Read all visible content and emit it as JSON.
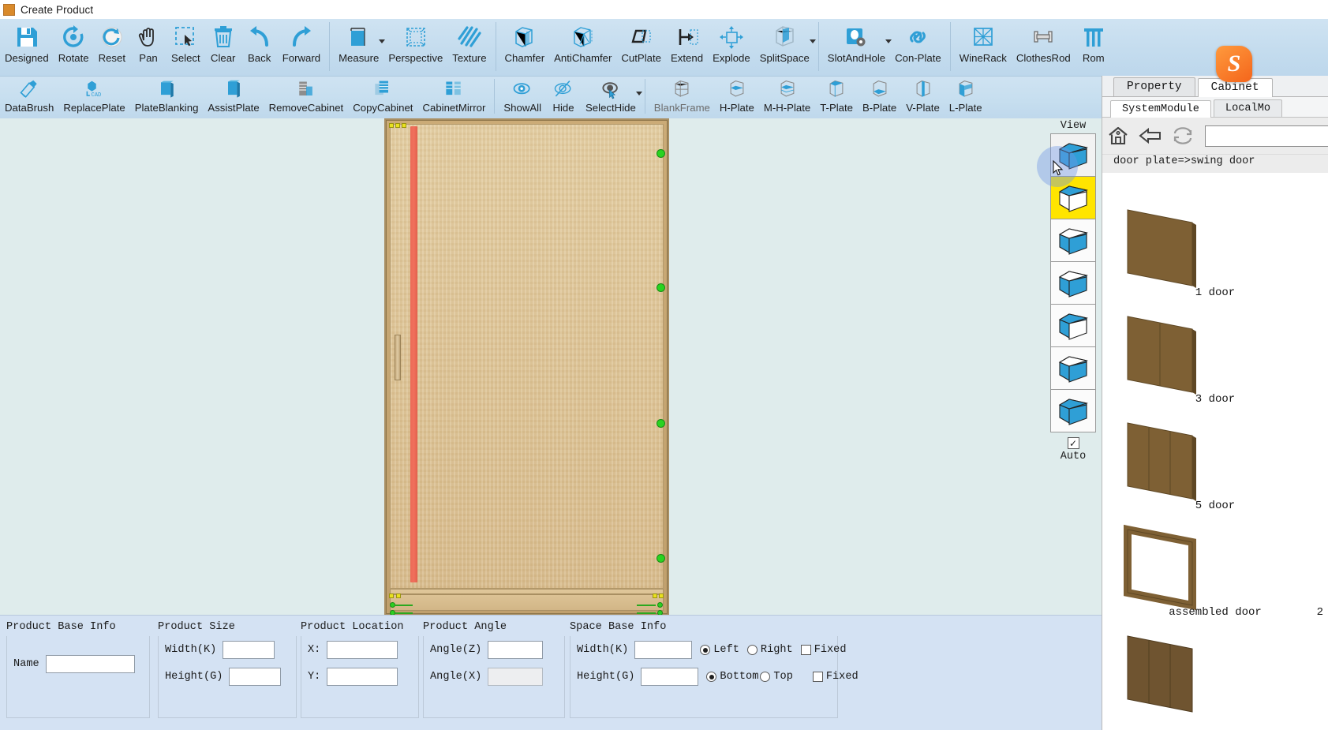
{
  "window": {
    "title": "Create Product"
  },
  "ribbon_row1": [
    {
      "label": "Designed",
      "icon": "save-icon"
    },
    {
      "label": "Rotate",
      "icon": "rotate-icon"
    },
    {
      "label": "Reset",
      "icon": "reset-icon"
    },
    {
      "label": "Pan",
      "icon": "hand-icon"
    },
    {
      "label": "Select",
      "icon": "marquee-select-icon"
    },
    {
      "label": "Clear",
      "icon": "trash-icon"
    },
    {
      "label": "Back",
      "icon": "undo-arrow-icon"
    },
    {
      "label": "Forward",
      "icon": "redo-arrow-icon"
    },
    {
      "label": "Measure",
      "icon": "measure-icon",
      "dropdown": true
    },
    {
      "label": "Perspective",
      "icon": "perspective-icon"
    },
    {
      "label": "Texture",
      "icon": "texture-icon"
    },
    {
      "label": "Chamfer",
      "icon": "chamfer-icon"
    },
    {
      "label": "AntiChamfer",
      "icon": "antichamfer-icon"
    },
    {
      "label": "CutPlate",
      "icon": "cutplate-icon"
    },
    {
      "label": "Extend",
      "icon": "extend-icon"
    },
    {
      "label": "Explode",
      "icon": "explode-icon"
    },
    {
      "label": "SplitSpace",
      "icon": "splitspace-icon",
      "dropdown": true
    },
    {
      "label": "SlotAndHole",
      "icon": "slotandhole-icon",
      "dropdown": true
    },
    {
      "label": "Con-Plate",
      "icon": "chain-link-icon"
    },
    {
      "label": "WineRack",
      "icon": "winerack-icon"
    },
    {
      "label": "ClothesRod",
      "icon": "clothesrod-icon"
    },
    {
      "label": "Rom",
      "icon": "roman-column-icon"
    }
  ],
  "ribbon_row2": [
    {
      "label": "DataBrush",
      "icon": "brush-icon"
    },
    {
      "label": "ReplacePlate",
      "icon": "cad-replace-icon"
    },
    {
      "label": "PlateBlanking",
      "icon": "plate-icon"
    },
    {
      "label": "AssistPlate",
      "icon": "assist-plate-icon"
    },
    {
      "label": "RemoveCabinet",
      "icon": "remove-cabinet-icon"
    },
    {
      "label": "CopyCabinet",
      "icon": "copy-cabinet-icon"
    },
    {
      "label": "CabinetMirror",
      "icon": "cabinet-mirror-icon"
    },
    {
      "label": "ShowAll",
      "icon": "eye-icon"
    },
    {
      "label": "Hide",
      "icon": "eye-slash-icon"
    },
    {
      "label": "SelectHide",
      "icon": "select-hide-icon",
      "dropdown": true
    },
    {
      "label": "BlankFrame",
      "icon": "blank-frame-icon",
      "dim": true
    },
    {
      "label": "H-Plate",
      "icon": "h-plate-icon"
    },
    {
      "label": "M-H-Plate",
      "icon": "mh-plate-icon"
    },
    {
      "label": "T-Plate",
      "icon": "t-plate-icon"
    },
    {
      "label": "B-Plate",
      "icon": "b-plate-icon"
    },
    {
      "label": "V-Plate",
      "icon": "v-plate-icon"
    },
    {
      "label": "L-Plate",
      "icon": "l-plate-icon"
    }
  ],
  "ribbon_overflow": "»",
  "view_panel": {
    "title": "View",
    "auto_label": "Auto",
    "auto_checked": true,
    "cubes": [
      {
        "name": "view-iso-front",
        "state": "selected"
      },
      {
        "name": "view-front-highlight",
        "state": "highlighted"
      },
      {
        "name": "view-iso-top-left",
        "state": "normal"
      },
      {
        "name": "view-iso-top-right",
        "state": "normal"
      },
      {
        "name": "view-iso-bottom",
        "state": "normal"
      },
      {
        "name": "view-iso-top",
        "state": "normal"
      },
      {
        "name": "view-iso-side",
        "state": "normal"
      }
    ]
  },
  "right_panel": {
    "tabs": [
      {
        "label": "Property",
        "active": false
      },
      {
        "label": "Cabinet",
        "active": true
      }
    ],
    "subtabs": [
      {
        "label": "SystemModule",
        "active": true
      },
      {
        "label": "LocalMo",
        "active": false
      }
    ],
    "nav": [
      {
        "name": "home-icon"
      },
      {
        "name": "back-arrow-icon"
      },
      {
        "name": "refresh-icon"
      }
    ],
    "search_value": "",
    "breadcrumb": "door plate=>swing door",
    "modules": [
      {
        "label": "1 door",
        "thumb": "door-panel-1",
        "num": ""
      },
      {
        "label": "3 door",
        "thumb": "door-panel-3",
        "num": ""
      },
      {
        "label": "5 door",
        "thumb": "door-panel-5",
        "num": ""
      },
      {
        "label": "assembled door",
        "thumb": "door-frame",
        "num": "2"
      },
      {
        "label": "",
        "thumb": "door-panel-dark",
        "num": ""
      }
    ]
  },
  "bottom_form": {
    "base_info": {
      "title": "Product Base Info",
      "name_label": "Name",
      "name_value": ""
    },
    "size": {
      "title": "Product Size",
      "width_label": "Width(K)",
      "width_value": "",
      "height_label": "Height(G)",
      "height_value": ""
    },
    "location": {
      "title": "Product Location",
      "x_label": "X:",
      "x_value": "",
      "y_label": "Y:",
      "y_value": ""
    },
    "angle": {
      "title": "Product Angle",
      "z_label": "Angle(Z)",
      "z_value": "",
      "x_label": "Angle(X)",
      "x_value": ""
    },
    "space": {
      "title": "Space Base Info",
      "width_label": "Width(K)",
      "width_value": "",
      "height_label": "Height(G)",
      "height_value": "",
      "left_label": "Left",
      "right_label": "Right",
      "bottom_label": "Bottom",
      "top_label": "Top",
      "fixed_label_1": "Fixed",
      "fixed_label_2": "Fixed",
      "horizontal_selected": "Left",
      "vertical_selected": "Bottom"
    }
  },
  "colors": {
    "ribbon_bg": "#c8dfee",
    "canvas_bg": "#dfecec",
    "form_bg": "#d4e2f3",
    "icon_blue": "#2f9fd6",
    "highlight_yellow": "#ffe500",
    "grip_green": "#29d320",
    "stripe_red": "#ec6a57",
    "brand_orange": "#f4651b"
  }
}
